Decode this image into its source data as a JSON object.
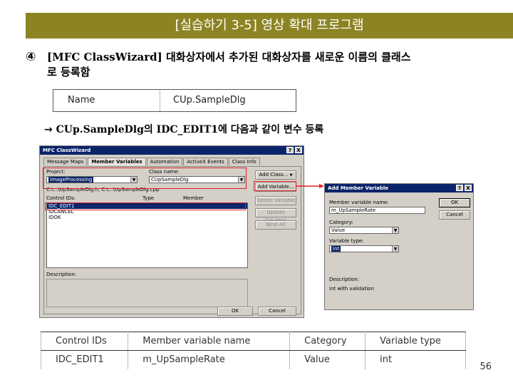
{
  "slide": {
    "title": "[실습하기 3-5] 영상 확대 프로그램",
    "step_num": "④",
    "step_part1": "[MFC ClassWizard]",
    "step_part2": " 대화상자에서 추가된 대화상자를 새로운 이름의 클래스",
    "step_line2": "로 등록함",
    "arrow_prefix": "→ ",
    "arrow_class": "CUp.SampleDlg",
    "arrow_mid": "의 ",
    "arrow_id": "IDC_EDIT1",
    "arrow_suffix": "에 다음과 같이 변수 등록",
    "page_number": "56"
  },
  "name_table": {
    "label": "Name",
    "value": "CUp.SampleDlg"
  },
  "classwizard": {
    "title": "MFC ClassWizard",
    "help_btn": "?",
    "close_btn": "X",
    "tabs": [
      "Message Maps",
      "Member Variables",
      "Automation",
      "ActiveX Events",
      "Class Info"
    ],
    "project_label": "Project:",
    "project_value": "ImageProcessing",
    "classname_label": "Class name:",
    "classname_value": "CUpSampleDlg",
    "file_path": "C:\\...\\UpSampleDlg.h, C:\\...\\UpSampleDlg.cpp",
    "col_control": "Control IDs:",
    "col_type": "Type",
    "col_member": "Member",
    "controls": [
      "IDC_EDIT1",
      "IDCANCEL",
      "IDOK"
    ],
    "description_label": "Description:",
    "buttons": {
      "add_class": "Add Class...",
      "add_variable": "Add Variable...",
      "delete_variable": "Delete Variable",
      "update_columns": "Update Columns",
      "bind_all": "Bind All",
      "ok": "OK",
      "cancel": "Cancel"
    }
  },
  "add_member": {
    "title": "Add Member Variable",
    "name_label": "Member variable name:",
    "name_value": "m_UpSampleRate",
    "category_label": "Category:",
    "category_value": "Value",
    "type_label": "Variable type:",
    "type_value": "int",
    "description_label": "Description:",
    "description_value": "int with validation",
    "ok": "OK",
    "cancel": "Cancel"
  },
  "result_table": {
    "headers": [
      "Control IDs",
      "Member variable name",
      "Category",
      "Variable type"
    ],
    "row": [
      "IDC_EDIT1",
      "m_UpSampleRate",
      "Value",
      "int"
    ]
  },
  "colors": {
    "title_bg": "#8c8422",
    "highlight": "#e02020",
    "win_title": "#0a246a",
    "dialog_bg": "#d4d0c8"
  }
}
